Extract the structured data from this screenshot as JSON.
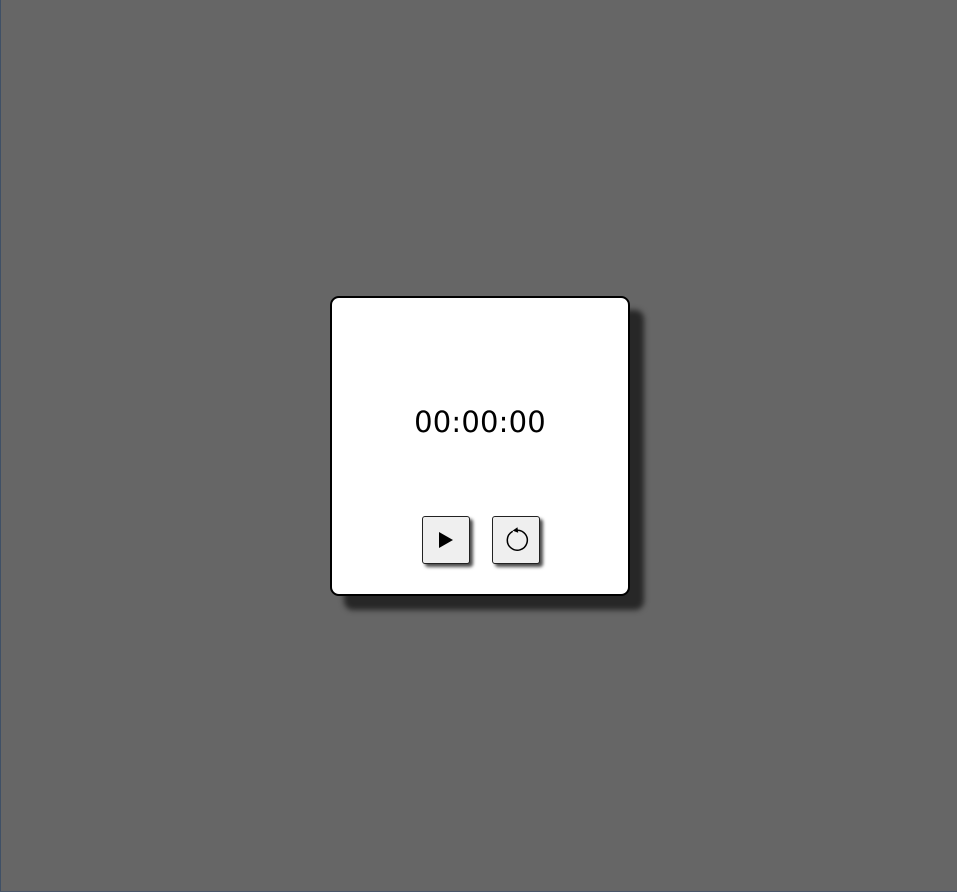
{
  "timer": {
    "display": "00:00:00"
  },
  "controls": {
    "play_icon": "play-icon",
    "reset_icon": "reset-icon"
  },
  "colors": {
    "background": "#666666",
    "card": "#ffffff",
    "button": "#efefef"
  }
}
